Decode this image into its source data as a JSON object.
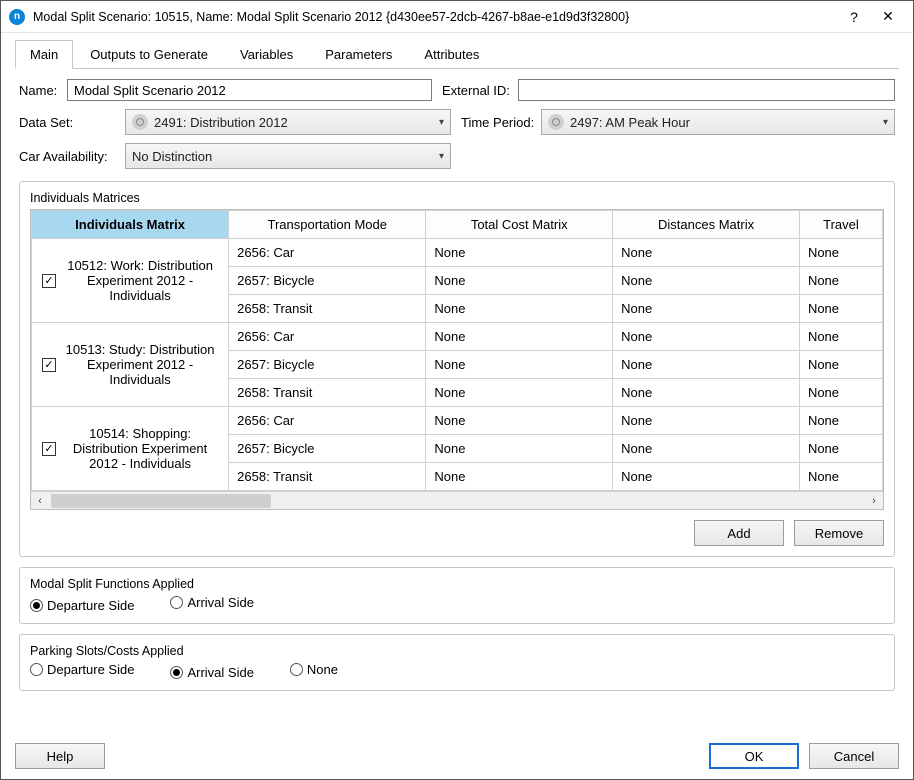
{
  "window": {
    "title": "Modal Split Scenario: 10515, Name: Modal Split Scenario 2012  {d430ee57-2dcb-4267-b8ae-e1d9d3f32800}",
    "help_btn": "?",
    "close_btn": "✕",
    "app_letter": "n"
  },
  "tabs": [
    "Main",
    "Outputs to Generate",
    "Variables",
    "Parameters",
    "Attributes"
  ],
  "active_tab": 0,
  "form": {
    "name_label": "Name:",
    "name_value": "Modal Split Scenario 2012",
    "extid_label": "External ID:",
    "extid_value": "",
    "dataset_label": "Data Set:",
    "dataset_value": "2491: Distribution 2012",
    "timeperiod_label": "Time Period:",
    "timeperiod_value": "2497: AM Peak Hour",
    "caravail_label": "Car Availability:",
    "caravail_value": "No Distinction"
  },
  "matrices_group": {
    "legend": "Individuals Matrices",
    "headers": [
      "Individuals Matrix",
      "Transportation Mode",
      "Total Cost Matrix",
      "Distances Matrix",
      "Travel"
    ],
    "col_widths": [
      "190px",
      "190px",
      "180px",
      "180px",
      "80px"
    ],
    "groups": [
      {
        "checked": true,
        "label": "10512: Work: Distribution Experiment 2012 - Individuals",
        "rows": [
          {
            "mode": "2656: Car",
            "cost": "None",
            "dist": "None",
            "travel": "None"
          },
          {
            "mode": "2657: Bicycle",
            "cost": "None",
            "dist": "None",
            "travel": "None"
          },
          {
            "mode": "2658: Transit",
            "cost": "None",
            "dist": "None",
            "travel": "None"
          }
        ]
      },
      {
        "checked": true,
        "label": "10513: Study: Distribution Experiment 2012 - Individuals",
        "rows": [
          {
            "mode": "2656: Car",
            "cost": "None",
            "dist": "None",
            "travel": "None"
          },
          {
            "mode": "2657: Bicycle",
            "cost": "None",
            "dist": "None",
            "travel": "None"
          },
          {
            "mode": "2658: Transit",
            "cost": "None",
            "dist": "None",
            "travel": "None"
          }
        ]
      },
      {
        "checked": true,
        "label": "10514: Shopping: Distribution Experiment 2012 - Individuals",
        "rows": [
          {
            "mode": "2656: Car",
            "cost": "None",
            "dist": "None",
            "travel": "None"
          },
          {
            "mode": "2657: Bicycle",
            "cost": "None",
            "dist": "None",
            "travel": "None"
          },
          {
            "mode": "2658: Transit",
            "cost": "None",
            "dist": "None",
            "travel": "None"
          }
        ]
      }
    ],
    "add_btn": "Add",
    "remove_btn": "Remove"
  },
  "modal_split_group": {
    "legend": "Modal Split Functions Applied",
    "options": [
      {
        "label": "Departure Side",
        "checked": true
      },
      {
        "label": "Arrival Side",
        "checked": false
      }
    ]
  },
  "parking_group": {
    "legend": "Parking Slots/Costs Applied",
    "options": [
      {
        "label": "Departure Side",
        "checked": false
      },
      {
        "label": "Arrival Side",
        "checked": true
      },
      {
        "label": "None",
        "checked": false
      }
    ]
  },
  "footer": {
    "help": "Help",
    "ok": "OK",
    "cancel": "Cancel"
  }
}
